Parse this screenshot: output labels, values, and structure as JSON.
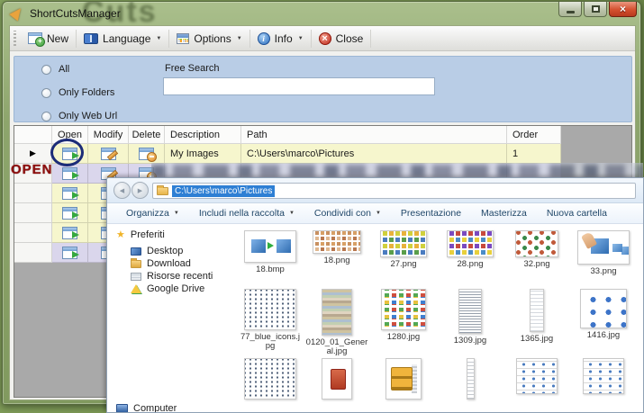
{
  "window": {
    "title": "ShortCutsManager",
    "wallpaper_text": "Cuts"
  },
  "toolbar": {
    "items": [
      {
        "label": "New",
        "icon": "new-shortcut-icon",
        "has_dropdown": false
      },
      {
        "label": "Language",
        "icon": "language-book-icon",
        "has_dropdown": true
      },
      {
        "label": "Options",
        "icon": "options-grid-icon",
        "has_dropdown": true
      },
      {
        "label": "Info",
        "icon": "info-icon",
        "has_dropdown": true
      },
      {
        "label": "Close",
        "icon": "close-app-icon",
        "has_dropdown": false
      }
    ]
  },
  "filter_panel": {
    "options": [
      {
        "label": "All",
        "selected": false
      },
      {
        "label": "Only Folders",
        "selected": false
      },
      {
        "label": "Only Web Url",
        "selected": false
      }
    ],
    "free_search_label": "Free Search",
    "free_search_value": ""
  },
  "grid": {
    "columns": [
      "Open",
      "Modify",
      "Delete",
      "Description",
      "Path",
      "Order"
    ],
    "rows": [
      {
        "description": "My Images",
        "path": "C:\\Users\\marco\\Pictures",
        "order": "1",
        "row_color": "yellow",
        "selected": true,
        "content_redacted": false
      },
      {
        "description": "",
        "path": "",
        "order": "",
        "row_color": "lavender",
        "selected": false,
        "content_redacted": true
      },
      {
        "description": "",
        "path": "",
        "order": "",
        "row_color": "yellow",
        "selected": false,
        "content_redacted": true
      },
      {
        "description": "",
        "path": "",
        "order": "",
        "row_color": "yellow",
        "selected": false,
        "content_redacted": true
      },
      {
        "description": "",
        "path": "",
        "order": "",
        "row_color": "yellow",
        "selected": false,
        "content_redacted": true
      },
      {
        "description": "",
        "path": "",
        "order": "",
        "row_color": "lavender",
        "selected": false,
        "content_redacted": true
      }
    ]
  },
  "annotations": {
    "open_label": "OPEN",
    "highlight_circle_on": "first row open button",
    "blurred_row_overlay": true
  },
  "explorer": {
    "address": "C:\\Users\\marco\\Pictures",
    "toolbar": [
      {
        "label": "Organizza",
        "has_dropdown": true
      },
      {
        "label": "Includi nella raccolta",
        "has_dropdown": true
      },
      {
        "label": "Condividi con",
        "has_dropdown": true
      },
      {
        "label": "Presentazione",
        "has_dropdown": false
      },
      {
        "label": "Masterizza",
        "has_dropdown": false
      },
      {
        "label": "Nuova cartella",
        "has_dropdown": false
      }
    ],
    "sidebar": {
      "favorites_label": "Preferiti",
      "favorites": [
        {
          "label": "Desktop",
          "icon": "desktop-icon"
        },
        {
          "label": "Download",
          "icon": "download-folder-icon"
        },
        {
          "label": "Risorse recenti",
          "icon": "recent-places-icon"
        },
        {
          "label": "Google Drive",
          "icon": "google-drive-icon"
        }
      ],
      "computer_label": "Computer"
    },
    "files_row1": [
      {
        "name": "18.bmp",
        "thumb": "computers-transfer"
      },
      {
        "name": "18.png",
        "thumb": "icon-grid-pastel"
      },
      {
        "name": "27.png",
        "thumb": "icon-grid-colorful"
      },
      {
        "name": "28.png",
        "thumb": "icon-grid-colorful2"
      },
      {
        "name": "32.png",
        "thumb": "icon-grid-sparse"
      },
      {
        "name": "33.png",
        "thumb": "hand-monitors"
      }
    ],
    "files_row2": [
      {
        "name": "77_blue_icons.jpg",
        "thumb": "icon-sheet-dense"
      },
      {
        "name": "0120_01_General.jpg",
        "thumb": "stripes-tall"
      },
      {
        "name": "1280.jpg",
        "thumb": "dot-grid"
      },
      {
        "name": "1309.jpg",
        "thumb": "text-strip-tall"
      },
      {
        "name": "1365.jpg",
        "thumb": "faint-strip-tall"
      },
      {
        "name": "1416.jpg",
        "thumb": "blue-icons-sheet"
      }
    ],
    "files_row3_partial": [
      {
        "thumb": "icon-sheet-dense"
      },
      {
        "thumb": "ttc-font-file"
      },
      {
        "thumb": "archive-file"
      },
      {
        "thumb": "thin-strip"
      },
      {
        "thumb": "icon-list"
      },
      {
        "thumb": "icon-list"
      }
    ]
  }
}
